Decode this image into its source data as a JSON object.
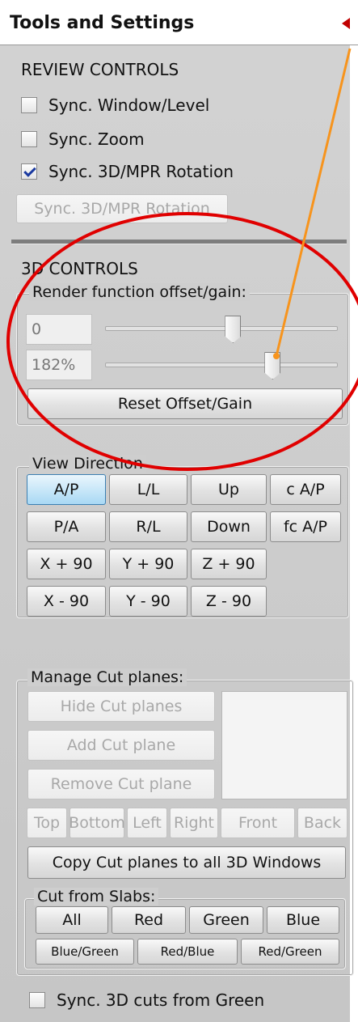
{
  "panel": {
    "title": "Tools and Settings"
  },
  "review": {
    "heading": "REVIEW CONTROLS",
    "sync_window_level": {
      "label": "Sync. Window/Level",
      "checked": false
    },
    "sync_zoom": {
      "label": "Sync. Zoom",
      "checked": false
    },
    "sync_3d_mpr": {
      "label": "Sync. 3D/MPR Rotation",
      "checked": true
    },
    "sync_button": "Sync. 3D/MPR Rotation"
  },
  "controls3d": {
    "heading": "3D CONTROLS",
    "render_group": "Render function offset/gain:",
    "offset_value": "0",
    "gain_value": "182%",
    "offset_level": 0.55,
    "gain_level": 0.72,
    "reset_button": "Reset Offset/Gain"
  },
  "view_direction": {
    "group": "View Direction",
    "buttons": [
      [
        "A/P",
        "L/L",
        "Up",
        "c A/P"
      ],
      [
        "P/A",
        "R/L",
        "Down",
        "fc A/P"
      ],
      [
        "X + 90",
        "Y + 90",
        "Z + 90"
      ],
      [
        "X - 90",
        "Y - 90",
        "Z - 90"
      ]
    ]
  },
  "cut_planes": {
    "group": "Manage Cut planes:",
    "hide": "Hide Cut planes",
    "add": "Add Cut plane",
    "remove": "Remove Cut plane",
    "faces": [
      "Top",
      "Bottom",
      "Left",
      "Right",
      "Front",
      "Back"
    ],
    "copy": "Copy Cut planes to all 3D Windows",
    "slabs_group": "Cut from Slabs:",
    "slabs_row1": [
      "All",
      "Red",
      "Green",
      "Blue"
    ],
    "slabs_row2": [
      "Blue/Green",
      "Red/Blue",
      "Red/Green"
    ]
  },
  "sync_cuts": {
    "label": "Sync. 3D cuts from Green",
    "checked": false
  },
  "colors": {
    "annotation_circle": "#e00000",
    "annotation_arrow": "#f7941d",
    "collapse_arrow": "#c00000"
  }
}
